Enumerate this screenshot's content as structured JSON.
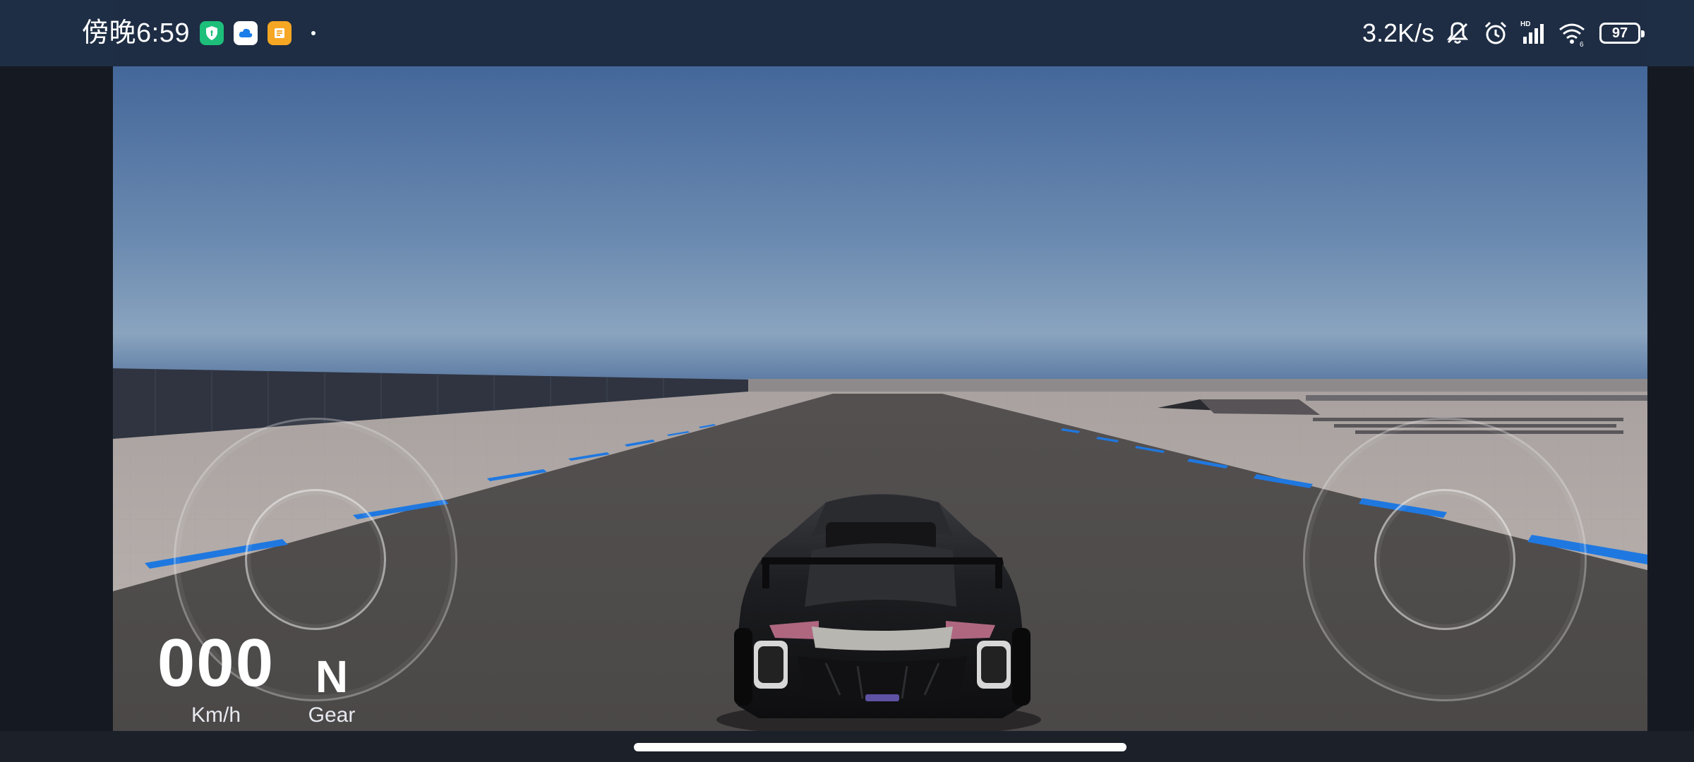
{
  "status_bar": {
    "time": "傍晚6:59",
    "network_speed": "3.2K/s",
    "battery_level": "97",
    "left_icons": [
      "security-shield-app-icon",
      "cloud-app-icon",
      "notes-app-icon"
    ],
    "right_icons": [
      "mute-bell-icon",
      "alarm-clock-icon",
      "hd-signal-icon",
      "wifi-6-icon",
      "battery-icon"
    ]
  },
  "hud": {
    "speed_value": "000",
    "speed_unit": "Km/h",
    "gear_value": "N",
    "gear_label": "Gear"
  },
  "controls": {
    "left_joystick": "steering-joystick",
    "right_joystick": "throttle-joystick"
  },
  "scene": {
    "sky_top": "#4a6d9b",
    "sky_horizon": "#8aa6c2",
    "road": "#4f4c4c",
    "ground": "#b2aba8",
    "curb_accent": "#1f78e0",
    "car": "#1a1a1c"
  }
}
